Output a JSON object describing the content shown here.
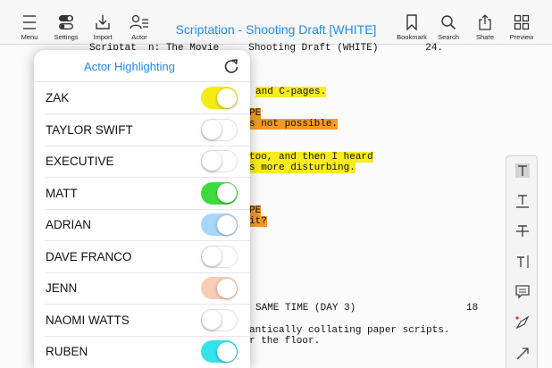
{
  "toolbar": {
    "title": "Scriptation - Shooting Draft [WHITE]",
    "menu_label": "Menu",
    "settings_label": "Settings",
    "import_label": "Import",
    "actor_label": "Actor",
    "bookmark_label": "Bookmark",
    "search_label": "Search",
    "share_label": "Share",
    "preview_label": "Preview"
  },
  "script": {
    "header_line": "Scriptat  n: The Movie     Shooting Draft (WHITE)        24.",
    "lines": [
      "and C-pages.",
      "PE",
      "s not possible.",
      "too, and then I heard",
      "s more disturbing.",
      "PE",
      "it?",
      "SAME TIME (DAY 3)",
      "18",
      "antically collating paper scripts.",
      "r the floor."
    ]
  },
  "popover": {
    "title": "Actor Highlighting",
    "actors": [
      {
        "name": "ZAK",
        "on": true,
        "color": "#f5ea14"
      },
      {
        "name": "TAYLOR SWIFT",
        "on": false,
        "color": "#ffffff"
      },
      {
        "name": "EXECUTIVE",
        "on": false,
        "color": "#ffffff"
      },
      {
        "name": "MATT",
        "on": true,
        "color": "#3ddc3d"
      },
      {
        "name": "ADRIAN",
        "on": true,
        "color": "#a9d6f6"
      },
      {
        "name": "DAVE FRANCO",
        "on": false,
        "color": "#ffffff"
      },
      {
        "name": "JENN",
        "on": true,
        "color": "#f8cdb5"
      },
      {
        "name": "NAOMI WATTS",
        "on": false,
        "color": "#ffffff"
      },
      {
        "name": "RUBEN",
        "on": true,
        "color": "#33e3ec"
      }
    ]
  },
  "palette": {
    "tools": [
      "text-highlight-tool",
      "text-underline-tool",
      "text-strikethrough-tool",
      "text-cursor-tool",
      "comment-tool",
      "pen-tool",
      "arrow-tool"
    ]
  },
  "colors": {
    "accent": "#1e8ce6",
    "highlight_yellow": "#f7ec1c",
    "highlight_orange": "#f39a23"
  }
}
